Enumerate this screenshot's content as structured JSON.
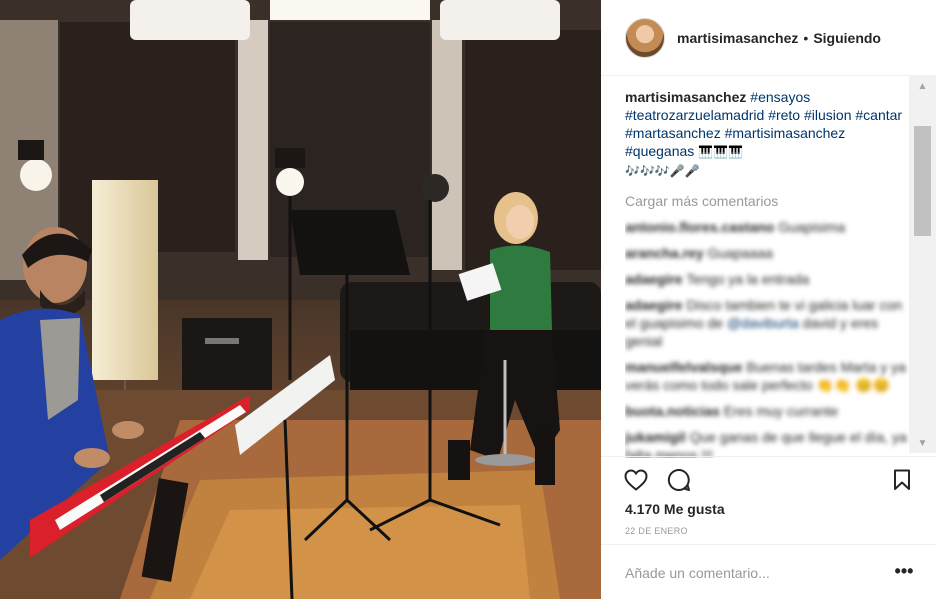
{
  "header": {
    "username": "martisimasanchez",
    "separator": "•",
    "follow_status": "Siguiendo"
  },
  "caption": {
    "username": "martisimasanchez",
    "tags": [
      "#ensayos",
      "#teatrozarzuelamadrid",
      "#reto",
      "#ilusion",
      "#cantar",
      "#martasanchez",
      "#martisimasanchez",
      "#queganas"
    ],
    "emoji_line1": "🎹🎹🎹",
    "emoji_line2": "🎶🎶🎶🎤🎤"
  },
  "load_more": "Cargar más comentarios",
  "comments": [
    {
      "user": "antonio.flores.castano",
      "text": "Guapisima"
    },
    {
      "user": "arancha.rey",
      "text": "Guapaaaa"
    },
    {
      "user": "adaegire",
      "text": "Tengo ya la entrada"
    },
    {
      "user": "adaegire",
      "text": "Disco tambien te vi galicia luar con el guapisimo de",
      "mention": "@daviburta",
      "text2": "david y eres genial"
    },
    {
      "user": "manuelfelvalsque",
      "text": "Buenas tardes Marta y ya verás como todo sale perfecto 👏👏 😊😊"
    },
    {
      "user": "buota.noticias",
      "text": "Eres muy currante"
    },
    {
      "user": "jukamigil",
      "text": "Que ganas de que llegue el día, ya falta menos !!!"
    }
  ],
  "actions": {
    "icons": [
      "heart-icon",
      "comment-icon",
      "bookmark-icon"
    ]
  },
  "likes": "4.170 Me gusta",
  "date": "22 DE ENERO",
  "comment_box": {
    "placeholder": "Añade un comentario...",
    "more": "•••"
  },
  "colors": {
    "link": "#003569",
    "muted": "#999999",
    "border": "#efefef",
    "keyboard_red": "#d9202b"
  }
}
